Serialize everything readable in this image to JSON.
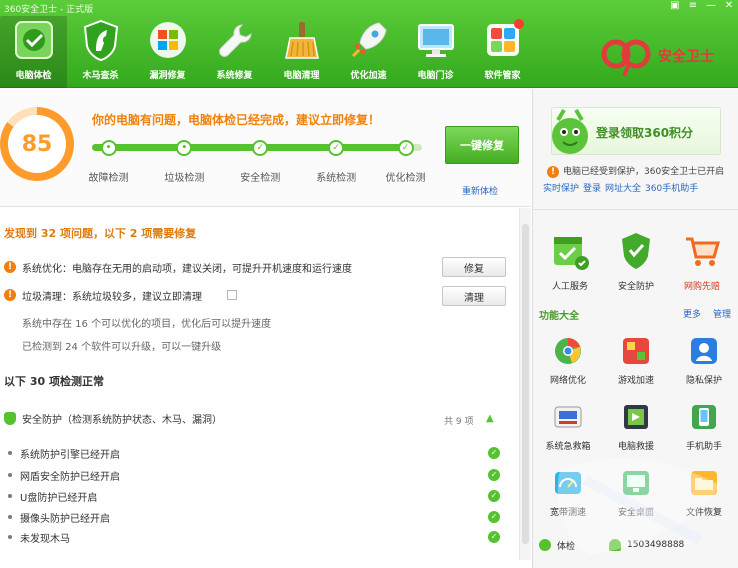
{
  "title": "360安全卫士 - 正式版",
  "window_controls": [
    {
      "name": "skin",
      "glyph": "▣"
    },
    {
      "name": "menu",
      "glyph": "≡"
    },
    {
      "name": "minimize",
      "glyph": "—"
    },
    {
      "name": "close",
      "glyph": "✕"
    }
  ],
  "toolbar": [
    {
      "label": "电脑体检",
      "icon": "check-icon"
    },
    {
      "label": "木马查杀",
      "icon": "horse-shield-icon"
    },
    {
      "label": "漏洞修复",
      "icon": "windows-icon"
    },
    {
      "label": "系统修复",
      "icon": "wrench-icon"
    },
    {
      "label": "电脑清理",
      "icon": "broom-icon"
    },
    {
      "label": "优化加速",
      "icon": "rocket-icon"
    },
    {
      "label": "电脑门诊",
      "icon": "computer-icon"
    },
    {
      "label": "软件管家",
      "icon": "apps-icon"
    }
  ],
  "brand": {
    "text": "安全卫士"
  },
  "score": {
    "value": "85",
    "level": 0.85,
    "headline": "你的电脑有问题，电脑体检已经完成，建议立即修复！",
    "action_label": "一键修复",
    "secondary_link": "重新体检",
    "progress": 0.96,
    "steps": [
      {
        "label": "故障检测",
        "pos": 0.05
      },
      {
        "label": "垃圾检测",
        "pos": 0.28
      },
      {
        "label": "安全检测",
        "pos": 0.51
      },
      {
        "label": "系统检测",
        "pos": 0.74
      },
      {
        "label": "优化检测",
        "pos": 0.95
      }
    ]
  },
  "issues_section": {
    "title": "发现到 32 项问题，以下 2 项需要修复",
    "items": [
      {
        "text": "系统优化：电脑存在无用的启动项，建议关闭，可提升开机速度和运行速度",
        "button": "修复"
      },
      {
        "text": "垃圾清理：系统垃圾较多，建议立即清理",
        "button": "清理"
      }
    ],
    "subs": [
      "系统中存在 16 个可以优化的项目，优化后可以提升速度",
      "已检测到 24 个软件可以升级，可以一键升级"
    ]
  },
  "ok_section": {
    "title": "以下 30 项检测正常",
    "group": {
      "label": "安全防护（检测系统防护状态、木马、漏洞）",
      "count": "共 9 项"
    },
    "items": [
      "系统防护引擎已经开启",
      "网盾安全防护已经开启",
      "U盘防护已经开启",
      "摄像头防护已经开启",
      "未发现木马"
    ]
  },
  "sidebar": {
    "promo": "登录领取360积分",
    "note": "电脑已经受到保护，360安全卫士已开启",
    "links": [
      "实时保护",
      "登录",
      "网址大全",
      "360手机助手"
    ],
    "big_tools": [
      {
        "label": "人工服务",
        "icon": "calendar-check-icon"
      },
      {
        "label": "安全防护",
        "icon": "shield-check-icon"
      },
      {
        "label": "网购先赔",
        "icon": "cart-icon"
      }
    ],
    "tools_title": "功能大全",
    "tools_links": [
      "更多",
      "管理"
    ],
    "tools": [
      {
        "label": "网络优化",
        "icon": "chrome-like-icon"
      },
      {
        "label": "游戏加速",
        "icon": "game-icon"
      },
      {
        "label": "隐私保护",
        "icon": "privacy-icon"
      },
      {
        "label": "系统急救箱",
        "icon": "drive-icon"
      },
      {
        "label": "电脑救援",
        "icon": "film-icon"
      },
      {
        "label": "手机助手",
        "icon": "phone-icon"
      },
      {
        "label": "宽带测速",
        "icon": "speed-icon"
      },
      {
        "label": "安全桌面",
        "icon": "desktop-icon"
      },
      {
        "label": "文件恢复",
        "icon": "folder-icon"
      }
    ],
    "status": [
      {
        "label": "体检",
        "icon": "status-icon"
      },
      {
        "label": "1503498888",
        "icon": "user-icon"
      }
    ]
  },
  "colors": {
    "green": "#57c230",
    "orange": "#f0820b",
    "blue": "#2b67c4"
  }
}
